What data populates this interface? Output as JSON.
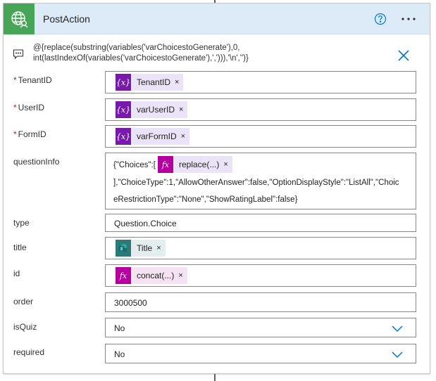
{
  "action": {
    "title": "PostAction",
    "header_icon": "globe-person-icon",
    "help_icon": "help-circle-icon",
    "more_icon": "ellipsis-icon"
  },
  "comment": {
    "icon": "comment-icon",
    "text": "@{replace(substring(variables('varChoicestoGenerate'),0,\nint(lastIndexOf(variables('varChoicestoGenerate'),','))),'\\n','')}",
    "close_icon": "close-icon"
  },
  "fields": {
    "tenant": {
      "label": "TenantID",
      "required": "*",
      "token": "TenantID",
      "token_icon": "{x}"
    },
    "user": {
      "label": "UserID",
      "required": "*",
      "token": "varUserID",
      "token_icon": "{x}"
    },
    "form": {
      "label": "FormID",
      "required": "*",
      "token": "varFormID",
      "token_icon": "{x}"
    },
    "question": {
      "label": "questionInfo",
      "prefix": "{\"Choices\":[",
      "token": "replace(...)",
      "token_icon": "fx",
      "line2": "],\"ChoiceType\":1,\"AllowOtherAnswer\":false,\"OptionDisplayStyle\":\"ListAll\",\"Choic",
      "line3": "eRestrictionType\":\"None\",\"ShowRatingLabel\":false}"
    },
    "type": {
      "label": "type",
      "value": "Question.Choice"
    },
    "title": {
      "label": "title",
      "token": "Title",
      "token_icon": "sharepoint-icon"
    },
    "id": {
      "label": "id",
      "token": "concat(...)",
      "token_icon": "fx"
    },
    "order": {
      "label": "order",
      "value": "3000500"
    },
    "isquiz": {
      "label": "isQuiz",
      "value": "No",
      "chevron_icon": "chevron-down-icon"
    },
    "required_field": {
      "label": "required",
      "value": "No",
      "chevron_icon": "chevron-down-icon"
    }
  },
  "token_remove": "×",
  "colors": {
    "header_bg": "#dcebf7",
    "header_icon_bg": "#46a556",
    "variable_token": "#7719aa",
    "expression_token": "#b4009e",
    "accent_blue": "#0078d4"
  }
}
